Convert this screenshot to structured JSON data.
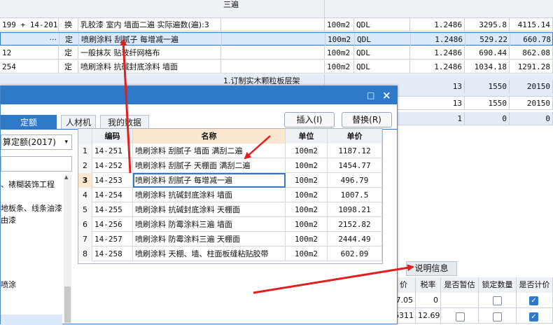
{
  "bg_table": {
    "top_note": "三遍",
    "rows": [
      {
        "code": "199 + 14-201",
        "type": "换",
        "name": "乳胶漆 室内 墙面二遍  实际遍数(遍):3",
        "spec": "",
        "unit": "100m2",
        "q": "QDL",
        "qty": "1.2486",
        "price": "3295.8",
        "total": "4115.14"
      },
      {
        "code": "",
        "more": "···",
        "type": "定",
        "name": "喷刷涂料 刮腻子 每增减一遍",
        "spec": "",
        "unit": "100m2",
        "q": "QDL",
        "qty": "1.2486",
        "price": "529.22",
        "total": "660.78"
      },
      {
        "code": "12",
        "type": "定",
        "name": "一般抹灰 贴玻纤网格布",
        "spec": "",
        "unit": "100m2",
        "q": "QDL",
        "qty": "1.2486",
        "price": "690.44",
        "total": "862.08"
      },
      {
        "code": "254",
        "type": "定",
        "name": "喷刷涂料 抗碱封底涂料 墙面",
        "spec": "",
        "unit": "100m2",
        "q": "QDL",
        "qty": "1.2486",
        "price": "1034.18",
        "total": "1291.28"
      },
      {
        "code": "",
        "type": "",
        "name": "",
        "spec": "1.订制实木颗粒板层架",
        "unit": "",
        "q": "",
        "qty": "13",
        "price": "1550",
        "total": "20150"
      },
      {
        "code": "",
        "type": "",
        "name": "",
        "spec": "",
        "unit": "",
        "q": "",
        "qty": "13",
        "price": "1550",
        "total": "20150"
      },
      {
        "code": "",
        "type": "",
        "name": "",
        "spec": "",
        "unit": "",
        "q": "",
        "qty": "1",
        "price": "0",
        "total": "0"
      }
    ]
  },
  "dialog": {
    "title_buttons": {
      "minimize": "□",
      "close": "×"
    },
    "tabs": [
      "定额",
      "人材机",
      "我的数据"
    ],
    "insert_button": "插入(I)",
    "replace_button": "替换(R)",
    "quota_select": "算定额(2017)",
    "tree_items": [
      "、裱糊装饰工程",
      "地板条、线条油漆",
      "由漆",
      "喷涂"
    ],
    "grid": {
      "headers": [
        "编码",
        "名称",
        "单位",
        "单价"
      ],
      "rows": [
        {
          "idx": "1",
          "code": "14-251",
          "name": "喷刷涂料 刮腻子 墙面 满刮二遍",
          "unit": "100m2",
          "price": "1187.12"
        },
        {
          "idx": "2",
          "code": "14-252",
          "name": "喷刷涂料 刮腻子 天棚面 满刮二遍",
          "unit": "100m2",
          "price": "1454.77"
        },
        {
          "idx": "3",
          "code": "14-253",
          "name": "喷刷涂料 刮腻子 每增减一遍",
          "unit": "100m2",
          "price": "496.79"
        },
        {
          "idx": "4",
          "code": "14-254",
          "name": "喷刷涂料 抗碱封底涂料 墙面",
          "unit": "100m2",
          "price": "1007.5"
        },
        {
          "idx": "5",
          "code": "14-255",
          "name": "喷刷涂料 抗碱封底涂料 天棚面",
          "unit": "100m2",
          "price": "1098.21"
        },
        {
          "idx": "6",
          "code": "14-256",
          "name": "喷刷涂料 防霉涂料三遍 墙面",
          "unit": "100m2",
          "price": "2152.82"
        },
        {
          "idx": "7",
          "code": "14-257",
          "name": "喷刷涂料 防霉涂料三遍 天棚面",
          "unit": "100m2",
          "price": "2444.49"
        },
        {
          "idx": "8",
          "code": "14-258",
          "name": "喷刷涂料 天棚、墙、柱面板缝粘贴胶带",
          "unit": "100m2",
          "price": "602.09"
        }
      ]
    }
  },
  "bottom_panel": {
    "tab": "说明信息",
    "headers": [
      "价",
      "税率",
      "是否暂估",
      "锁定数量",
      "是否计价"
    ],
    "rows": [
      {
        "price": "7.05",
        "rate": "0"
      },
      {
        "price": "6311",
        "rate": "12.69"
      }
    ]
  },
  "colors": {
    "accent": "#2f79c9",
    "arrow": "#e02020"
  }
}
